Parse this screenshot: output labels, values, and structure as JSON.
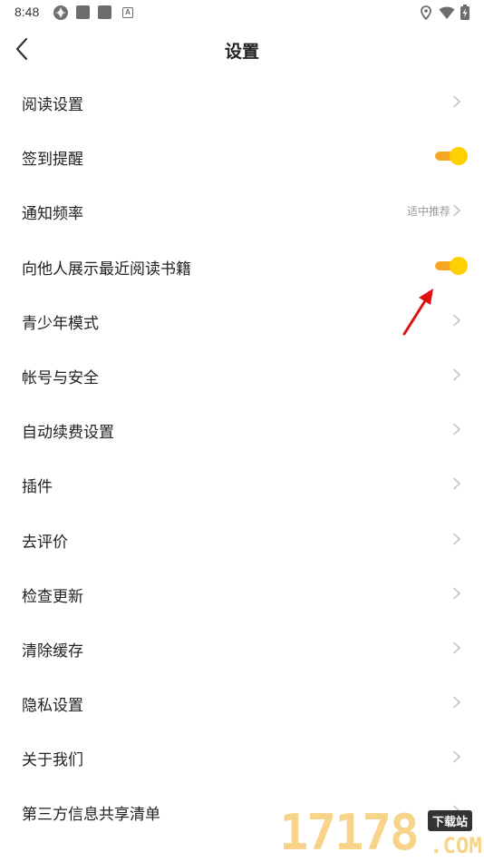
{
  "status_bar": {
    "time": "8:48",
    "left_icons": [
      "app-icon",
      "notification-square-icon",
      "notification-square-icon",
      "a-letter-icon"
    ],
    "a_glyph": "A",
    "right_icons": [
      "location-icon",
      "wifi-icon",
      "battery-charging-icon"
    ]
  },
  "header": {
    "title": "设置",
    "back_icon": "chevron-left-icon"
  },
  "rows": [
    {
      "label": "阅读设置"
    },
    {
      "label": "签到提醒",
      "toggle_on": true
    },
    {
      "label": "通知频率",
      "value": "适中推荐"
    },
    {
      "label": "向他人展示最近阅读书籍",
      "toggle_on": true
    },
    {
      "label": "青少年模式"
    },
    {
      "label": "帐号与安全"
    },
    {
      "label": "自动续费设置"
    },
    {
      "label": "插件"
    },
    {
      "label": "去评价"
    },
    {
      "label": "检查更新"
    },
    {
      "label": "清除缓存"
    },
    {
      "label": "隐私设置"
    },
    {
      "label": "关于我们"
    },
    {
      "label": "第三方信息共享清单"
    }
  ],
  "colors": {
    "accent_track": "#f5a623",
    "accent_thumb": "#ffd000",
    "annotation_arrow": "#e01010",
    "chevron": "#c4c4c4"
  },
  "watermark": {
    "digits": "17178",
    "tag": "下载站",
    "suffix": ".COM"
  }
}
